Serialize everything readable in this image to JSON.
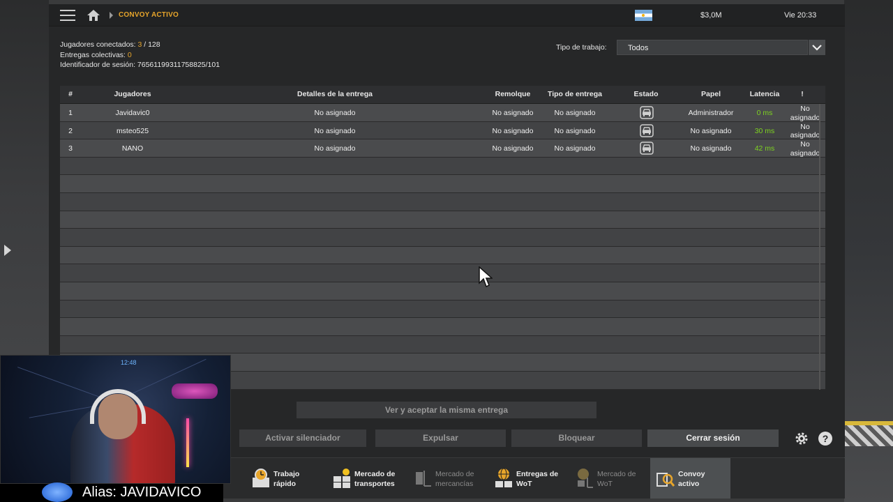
{
  "topbar": {
    "breadcrumb": "CONVOY ACTIVO",
    "money": "$3,0M",
    "datetime": "Vie 20:33",
    "flag_icon": "argentina-flag-icon"
  },
  "session": {
    "players_label": "Jugadores conectados:",
    "players_current": "3",
    "players_sep": " / 128",
    "deliveries_label": "Entregas colectivas:",
    "deliveries_value": "0",
    "session_id_label": "Identificador de sesión:",
    "session_id": "76561199311758825/101"
  },
  "filter": {
    "label": "Tipo de trabajo:",
    "value": "Todos"
  },
  "table": {
    "headers": {
      "num": "#",
      "players": "Jugadores",
      "details": "Detalles de la entrega",
      "trailer": "Remolque",
      "delivery_type": "Tipo de entrega",
      "status": "Estado",
      "role": "Papel",
      "latency": "Latencia",
      "warn": "!"
    },
    "rows": [
      {
        "num": "1",
        "player": "Javidavic0",
        "details": "No asignado",
        "trailer": "No asignado",
        "type": "No asignado",
        "role": "Administrador",
        "latency": "0 ms",
        "extra_1": "No",
        "extra_2": "asignado"
      },
      {
        "num": "2",
        "player": "msteo525",
        "details": "No asignado",
        "trailer": "No asignado",
        "type": "No asignado",
        "role": "No asignado",
        "latency": "30 ms",
        "extra_1": "No",
        "extra_2": "asignado"
      },
      {
        "num": "3",
        "player": "NANO",
        "details": "No asignado",
        "trailer": "No asignado",
        "type": "No asignado",
        "role": "No asignado",
        "latency": "42 ms",
        "extra_1": "No",
        "extra_2": "asignado"
      }
    ]
  },
  "actions": {
    "view_accept": "Ver y aceptar la misma entrega",
    "mute": "Activar silenciador",
    "kick": "Expulsar",
    "block": "Bloquear",
    "logout": "Cerrar sesión"
  },
  "tabs": [
    {
      "label": "Trabajo\nrápido",
      "icon": "clock-box-icon"
    },
    {
      "label": "Mercado de\ntransportes",
      "icon": "boxes-sun-icon"
    },
    {
      "label": "Mercado de\nmercancías",
      "icon": "cargo-trolley-icon"
    },
    {
      "label": "Entregas de\nWoT",
      "icon": "globe-boxes-icon"
    },
    {
      "label": "Mercado de\nWoT",
      "icon": "globe-trolley-icon"
    },
    {
      "label": "Convoy\nactivo",
      "icon": "convoy-search-icon"
    }
  ],
  "stream": {
    "alias": "Alias: JAVIDAVICO",
    "cam_clock": "12:48"
  },
  "colors": {
    "accent": "#e7a52b",
    "latency_good": "#7ed321",
    "panel": "#262728"
  }
}
